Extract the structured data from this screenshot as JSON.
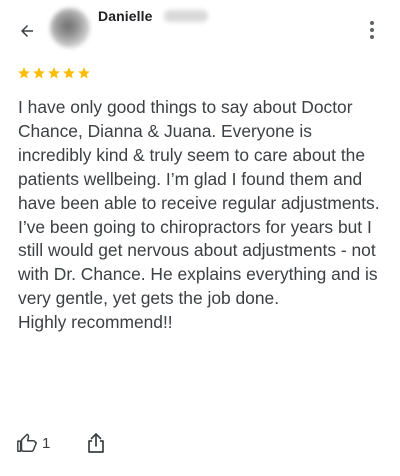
{
  "header": {
    "back_icon": "arrow-back-icon",
    "reviewer_name": "Danielle",
    "more_icon": "more-vert-icon"
  },
  "review": {
    "rating": 5,
    "rating_max": 5,
    "star_color": "#fbbc04",
    "text": "I have only good things to say about Doctor Chance, Dianna & Juana. Everyone is incredibly kind & truly seem to care about the patients wellbeing. I’m glad I found them and have been able to receive regular adjustments.\nI’ve been going to chiropractors for years but I still would get nervous about adjustments - not with Dr. Chance. He explains everything and is very gentle, yet gets the job done.\nHighly recommend!!"
  },
  "actions": {
    "like_icon": "thumb-up-icon",
    "like_count": "1",
    "share_icon": "share-icon"
  }
}
